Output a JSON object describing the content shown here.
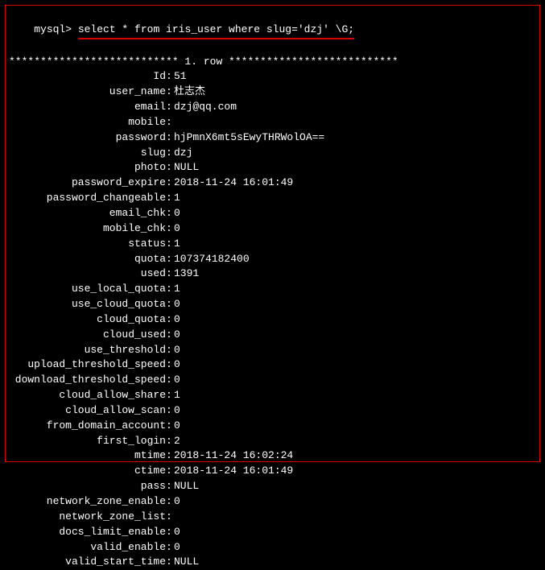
{
  "prompt": "mysql> ",
  "command": "select * from iris_user where slug='dzj' \\G;",
  "separator": "*************************** 1. row ***************************",
  "fields": [
    {
      "label": "Id",
      "value": "51"
    },
    {
      "label": "user_name",
      "value": "杜志杰"
    },
    {
      "label": "email",
      "value": "dzj@qq.com"
    },
    {
      "label": "mobile",
      "value": ""
    },
    {
      "label": "password",
      "value": "hjPmnX6mt5sEwyTHRWolOA=="
    },
    {
      "label": "slug",
      "value": "dzj"
    },
    {
      "label": "photo",
      "value": "NULL"
    },
    {
      "label": "password_expire",
      "value": "2018-11-24 16:01:49"
    },
    {
      "label": "password_changeable",
      "value": "1"
    },
    {
      "label": "email_chk",
      "value": "0"
    },
    {
      "label": "mobile_chk",
      "value": "0"
    },
    {
      "label": "status",
      "value": "1"
    },
    {
      "label": "quota",
      "value": "107374182400"
    },
    {
      "label": "used",
      "value": "1391"
    },
    {
      "label": "use_local_quota",
      "value": "1"
    },
    {
      "label": "use_cloud_quota",
      "value": "0"
    },
    {
      "label": "cloud_quota",
      "value": "0"
    },
    {
      "label": "cloud_used",
      "value": "0"
    },
    {
      "label": "use_threshold",
      "value": "0"
    },
    {
      "label": "upload_threshold_speed",
      "value": "0"
    },
    {
      "label": "download_threshold_speed",
      "value": "0"
    },
    {
      "label": "cloud_allow_share",
      "value": "1"
    },
    {
      "label": "cloud_allow_scan",
      "value": "0"
    },
    {
      "label": "from_domain_account",
      "value": "0"
    },
    {
      "label": "first_login",
      "value": "2"
    },
    {
      "label": "mtime",
      "value": "2018-11-24 16:02:24"
    },
    {
      "label": "ctime",
      "value": "2018-11-24 16:01:49"
    },
    {
      "label": "pass",
      "value": "NULL"
    },
    {
      "label": "network_zone_enable",
      "value": "0"
    },
    {
      "label": "network_zone_list",
      "value": ""
    },
    {
      "label": "docs_limit_enable",
      "value": "0"
    },
    {
      "label": "valid_enable",
      "value": "0"
    },
    {
      "label": "valid_start_time",
      "value": "NULL"
    }
  ]
}
